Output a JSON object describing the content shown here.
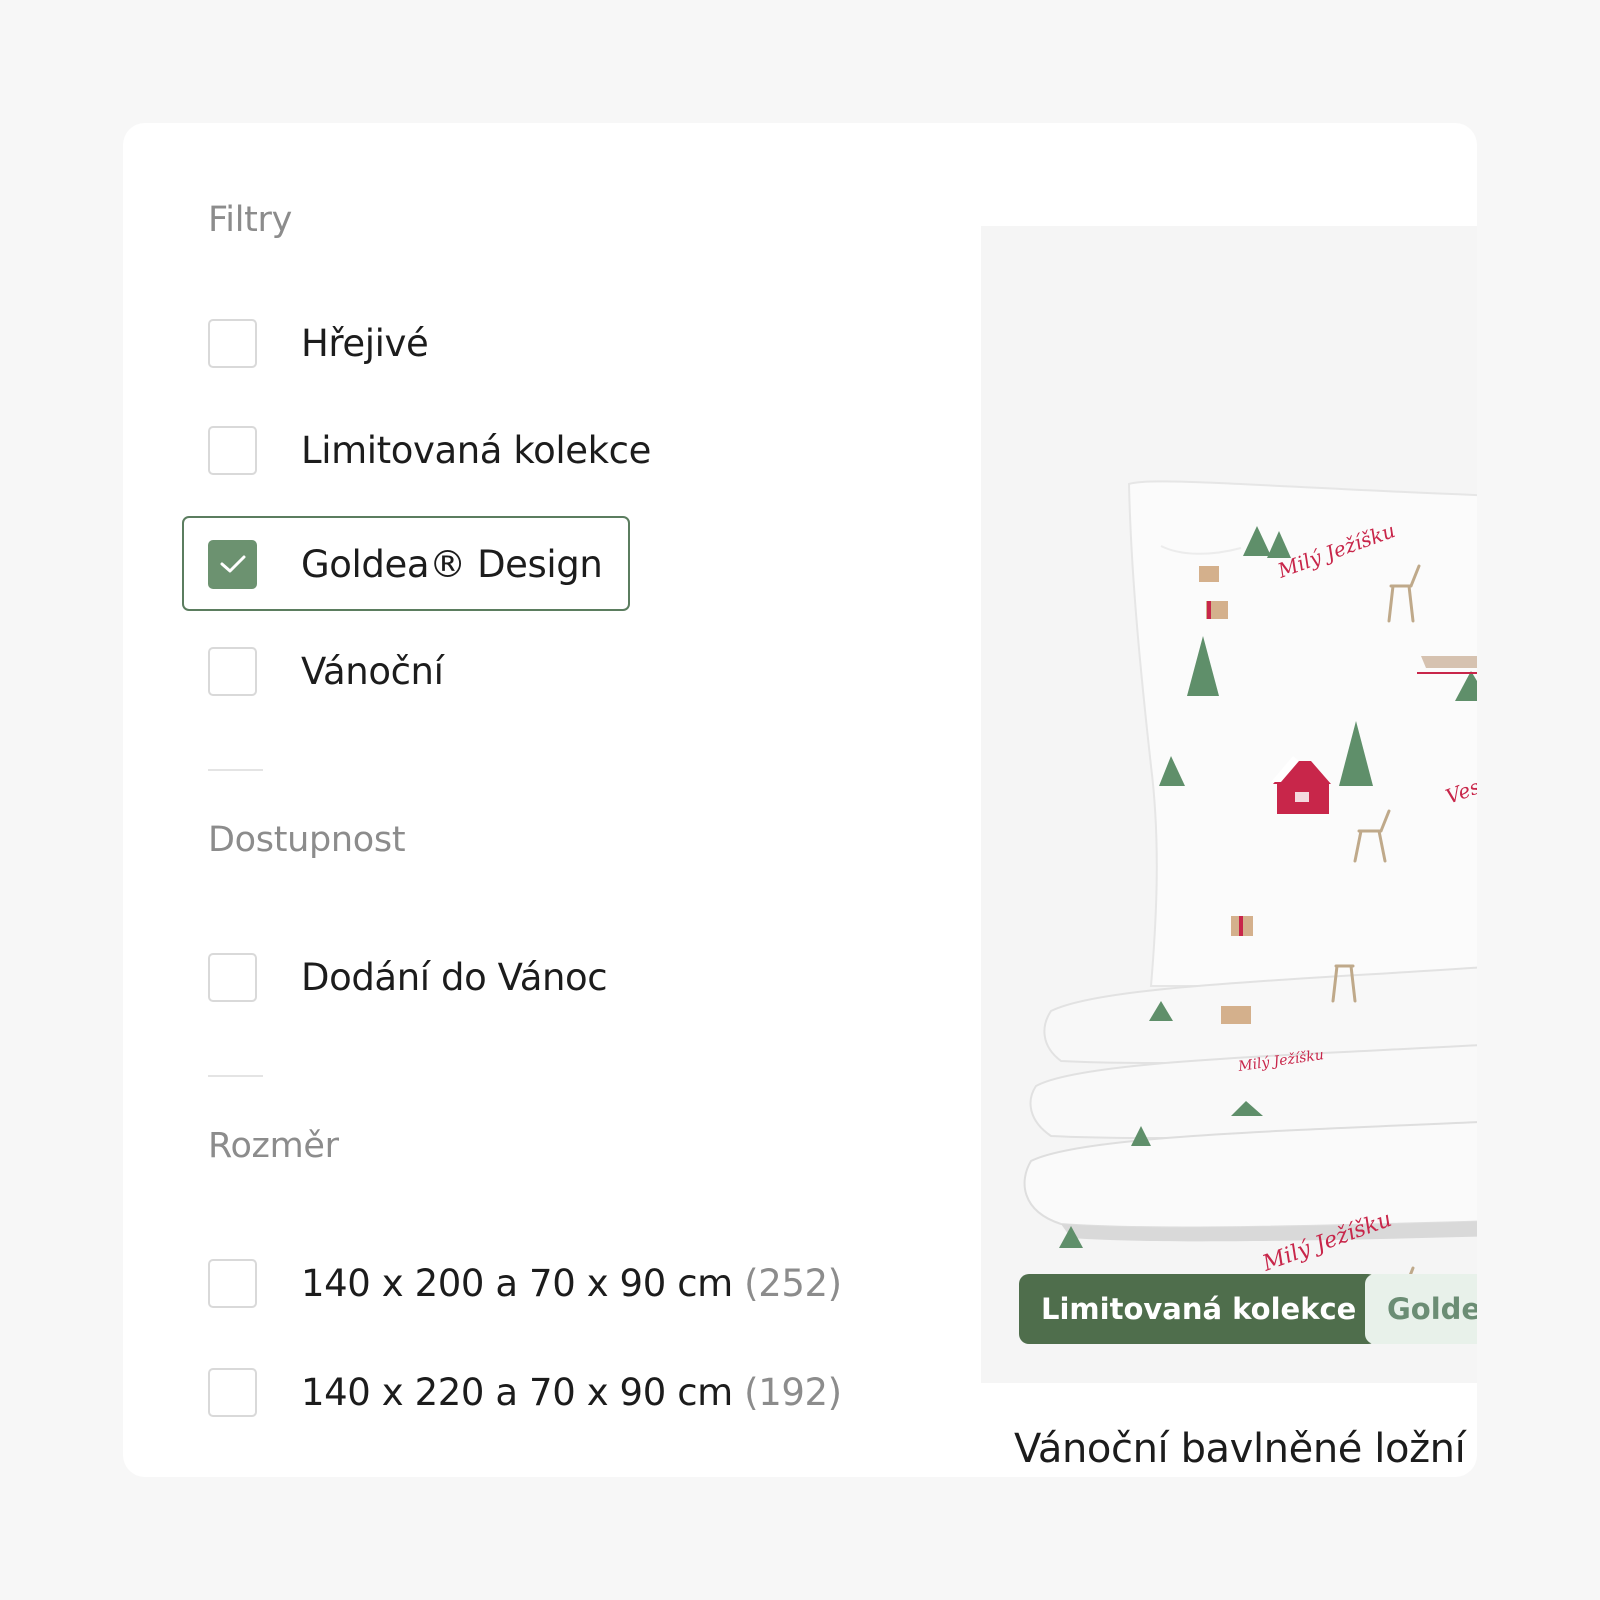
{
  "filters": {
    "title": "Filtry",
    "options": [
      {
        "label": "Hřejivé",
        "checked": false
      },
      {
        "label": "Limitovaná kolekce",
        "checked": false
      },
      {
        "label": "Goldea® Design",
        "checked": true
      },
      {
        "label": "Vánoční",
        "checked": false
      }
    ]
  },
  "availability": {
    "title": "Dostupnost",
    "options": [
      {
        "label": "Dodání do Vánoc",
        "checked": false
      }
    ]
  },
  "size": {
    "title": "Rozměr",
    "options": [
      {
        "label": "140 x 200 a 70 x 90 cm",
        "count": "(252)",
        "checked": false
      },
      {
        "label": "140 x 220 a 70 x 90 cm",
        "count": "(192)",
        "checked": false
      }
    ]
  },
  "product": {
    "badges": [
      "Limitovaná kolekce",
      "Golde"
    ],
    "title": "Vánoční bavlněné ložní",
    "print_text": [
      "Milý Ježíšku",
      "Veselé Vánoce"
    ]
  },
  "colors": {
    "accent_green": "#6c9270",
    "badge_dark_green": "#4f6e4c",
    "badge_light_green": "#e8f1ea",
    "print_red": "#c8264a"
  }
}
